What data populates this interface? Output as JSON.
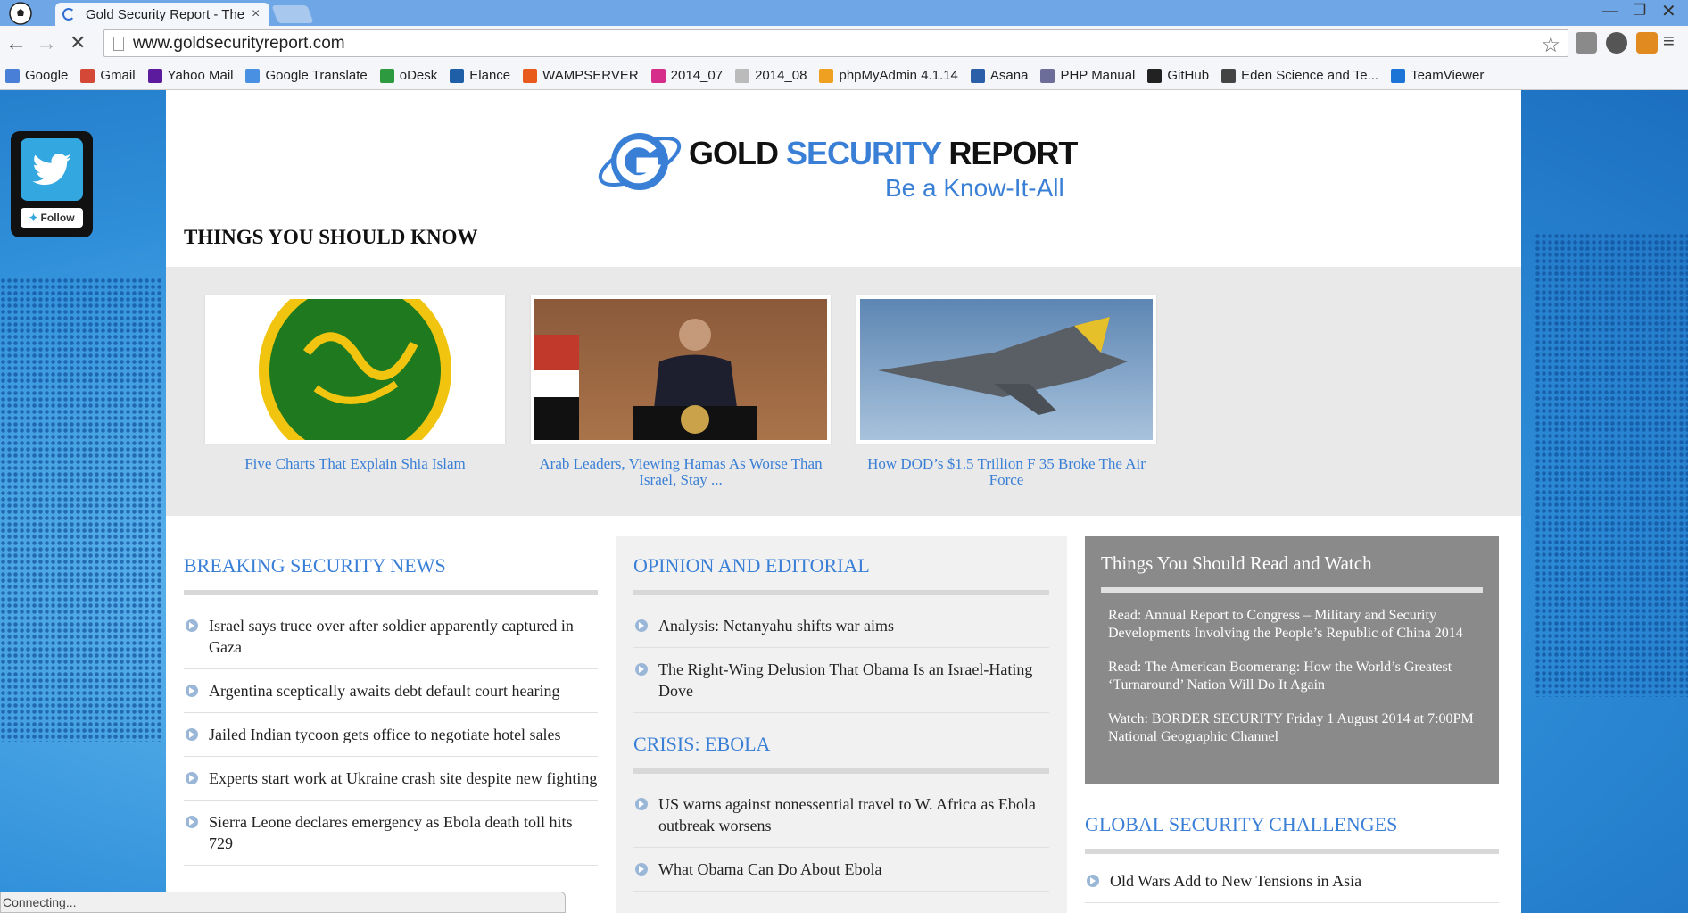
{
  "browser": {
    "tab_title": "Gold Security Report - The",
    "tab_close": "×",
    "url": "www.goldsecurityreport.com",
    "status": "Connecting...",
    "bookmarks": [
      {
        "label": "Google",
        "color": "#4a7fd8"
      },
      {
        "label": "Gmail",
        "color": "#d34836"
      },
      {
        "label": "Yahoo Mail",
        "color": "#5b1b9c"
      },
      {
        "label": "Google Translate",
        "color": "#4a90e2"
      },
      {
        "label": "oDesk",
        "color": "#2d9a3f"
      },
      {
        "label": "Elance",
        "color": "#1f5fa8"
      },
      {
        "label": "WAMPSERVER",
        "color": "#e85a1b"
      },
      {
        "label": "2014_07",
        "color": "#d62d8a"
      },
      {
        "label": "2014_08",
        "color": "#bbbbbb"
      },
      {
        "label": "phpMyAdmin 4.1.14",
        "color": "#f0a020"
      },
      {
        "label": "Asana",
        "color": "#2b5fa8"
      },
      {
        "label": "PHP Manual",
        "color": "#6d6d9a"
      },
      {
        "label": "GitHub",
        "color": "#222222"
      },
      {
        "label": "Eden Science and Te...",
        "color": "#444444"
      },
      {
        "label": "TeamViewer",
        "color": "#1b74d6"
      }
    ]
  },
  "twitter": {
    "follow_label": "Follow"
  },
  "site": {
    "logo_text_1": "GOLD",
    "logo_text_2": "SECURITY",
    "logo_text_3": "REPORT",
    "tagline": "Be a Know-It-All",
    "section_heading": "THINGS YOU SHOULD KNOW",
    "features": [
      {
        "caption": "Five Charts That Explain Shia Islam"
      },
      {
        "caption": "Arab Leaders, Viewing Hamas As Worse Than Israel, Stay ..."
      },
      {
        "caption": "How DOD’s $1.5 Trillion F 35 Broke The Air Force"
      }
    ],
    "breaking": {
      "heading": "BREAKING SECURITY NEWS",
      "items": [
        "Israel says truce over after soldier apparently captured in Gaza",
        "Argentina sceptically awaits debt default court hearing",
        "Jailed Indian tycoon gets office to negotiate hotel sales",
        "Experts start work at Ukraine crash site despite new fighting",
        "Sierra Leone declares emergency as Ebola death toll hits 729"
      ]
    },
    "opinion": {
      "heading": "OPINION AND EDITORIAL",
      "items": [
        "Analysis: Netanyahu shifts war aims",
        "The Right-Wing Delusion That Obama Is an Israel-Hating Dove"
      ]
    },
    "ebola": {
      "heading": "CRISIS: EBOLA",
      "items": [
        "US warns against nonessential travel to W. Africa as Ebola outbreak worsens",
        "What Obama Can Do About Ebola"
      ]
    },
    "read_watch": {
      "heading": "Things You Should Read and Watch",
      "items": [
        "Read: Annual Report to Congress – Military and Security Developments Involving the People’s Republic of China 2014",
        "Read: The American Boomerang: How the World’s Greatest ‘Turnaround’ Nation Will Do It Again",
        "Watch: BORDER SECURITY Friday 1 August 2014 at 7:00PM National Geographic Channel"
      ]
    },
    "global": {
      "heading": "GLOBAL SECURITY CHALLENGES",
      "items": [
        "Old Wars Add to New Tensions in Asia"
      ]
    }
  }
}
